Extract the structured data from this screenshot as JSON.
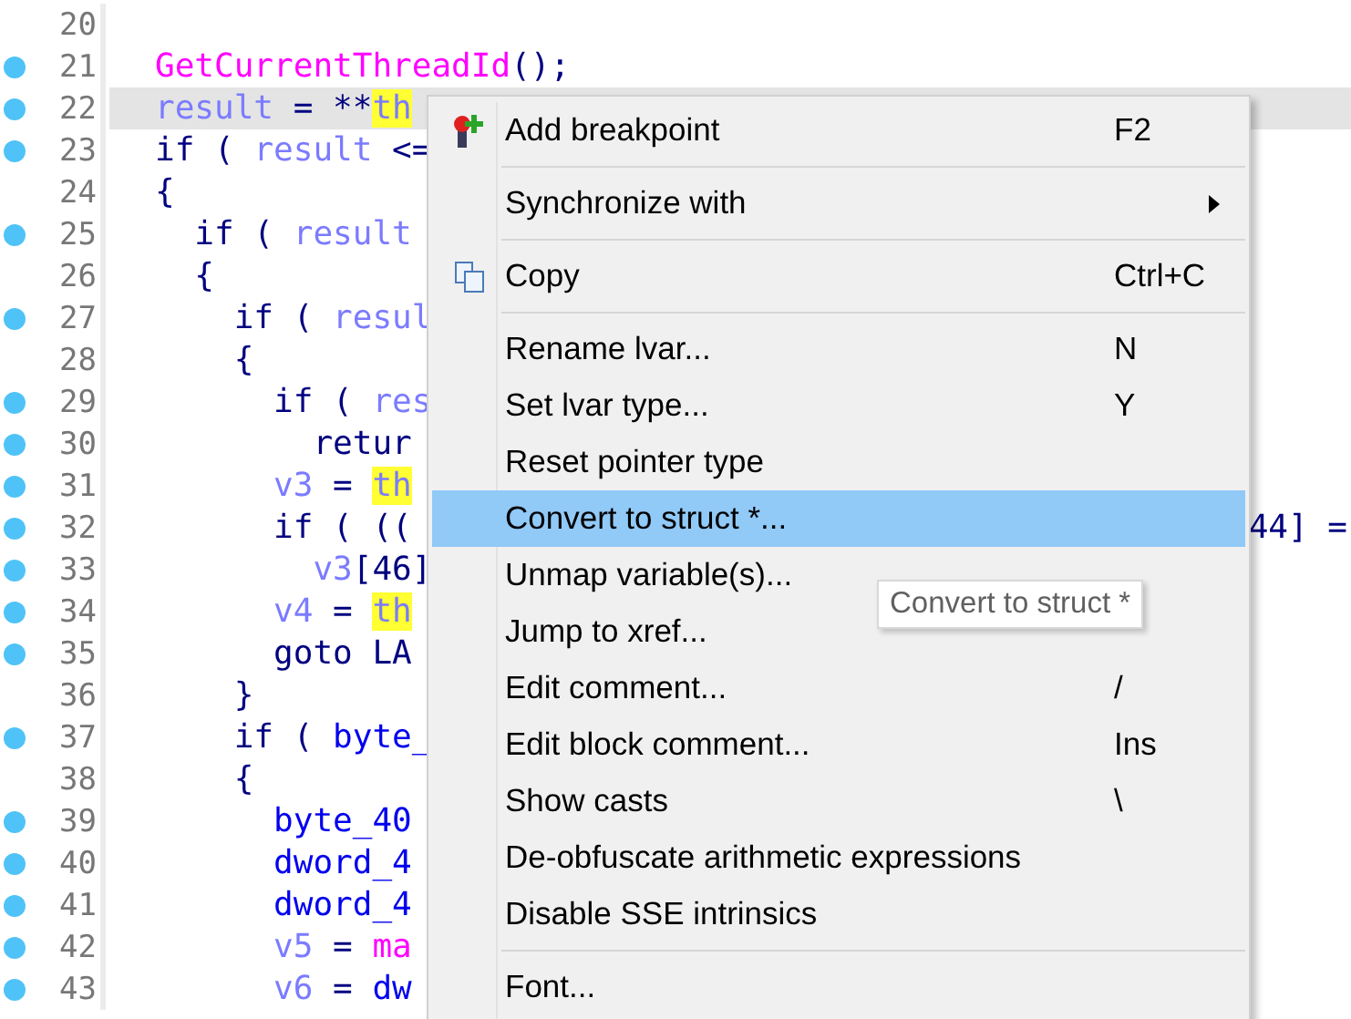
{
  "editor": {
    "lines": [
      {
        "number": "20",
        "breakpoint": false,
        "current": false
      },
      {
        "number": "21",
        "breakpoint": true,
        "current": false,
        "tokens": [
          {
            "text": "GetCurrentThreadId",
            "kind": "func"
          },
          {
            "text": "();",
            "kind": "plain"
          }
        ]
      },
      {
        "number": "22",
        "breakpoint": true,
        "current": true,
        "tokens": [
          {
            "text": "result",
            "kind": "var"
          },
          {
            "text": " = **",
            "kind": "plain"
          },
          {
            "text": "th",
            "kind": "highlight"
          }
        ]
      },
      {
        "number": "23",
        "breakpoint": true,
        "current": false,
        "tokens": [
          {
            "text": "if ( ",
            "kind": "plain"
          },
          {
            "text": "result",
            "kind": "var"
          },
          {
            "text": " <=",
            "kind": "plain"
          }
        ]
      },
      {
        "number": "24",
        "breakpoint": false,
        "current": false,
        "tokens": [
          {
            "text": "{",
            "kind": "plain"
          }
        ]
      },
      {
        "number": "25",
        "breakpoint": true,
        "current": false,
        "tokens": [
          {
            "text": "  if ( ",
            "kind": "plain"
          },
          {
            "text": "result",
            "kind": "var"
          }
        ]
      },
      {
        "number": "26",
        "breakpoint": false,
        "current": false,
        "tokens": [
          {
            "text": "  {",
            "kind": "plain"
          }
        ]
      },
      {
        "number": "27",
        "breakpoint": true,
        "current": false,
        "tokens": [
          {
            "text": "    if ( ",
            "kind": "plain"
          },
          {
            "text": "resul",
            "kind": "var"
          }
        ]
      },
      {
        "number": "28",
        "breakpoint": false,
        "current": false,
        "tokens": [
          {
            "text": "    {",
            "kind": "plain"
          }
        ]
      },
      {
        "number": "29",
        "breakpoint": true,
        "current": false,
        "tokens": [
          {
            "text": "      if ( ",
            "kind": "plain"
          },
          {
            "text": "res",
            "kind": "var"
          }
        ]
      },
      {
        "number": "30",
        "breakpoint": true,
        "current": false,
        "tokens": [
          {
            "text": "        retur",
            "kind": "plain"
          }
        ]
      },
      {
        "number": "31",
        "breakpoint": true,
        "current": false,
        "tokens": [
          {
            "text": "      v3",
            "kind": "var"
          },
          {
            "text": " = ",
            "kind": "plain"
          },
          {
            "text": "th",
            "kind": "highlight"
          }
        ]
      },
      {
        "number": "32",
        "breakpoint": true,
        "current": false,
        "tokens": [
          {
            "text": "      if ( ((",
            "kind": "plain"
          }
        ],
        "right_text": "44] ="
      },
      {
        "number": "33",
        "breakpoint": true,
        "current": false,
        "tokens": [
          {
            "text": "        v3",
            "kind": "var"
          },
          {
            "text": "[46]",
            "kind": "plain"
          }
        ]
      },
      {
        "number": "34",
        "breakpoint": true,
        "current": false,
        "tokens": [
          {
            "text": "      v4",
            "kind": "var"
          },
          {
            "text": " = ",
            "kind": "plain"
          },
          {
            "text": "th",
            "kind": "highlight"
          }
        ]
      },
      {
        "number": "35",
        "breakpoint": true,
        "current": false,
        "tokens": [
          {
            "text": "      goto LA",
            "kind": "plain"
          }
        ]
      },
      {
        "number": "36",
        "breakpoint": false,
        "current": false,
        "tokens": [
          {
            "text": "    }",
            "kind": "plain"
          }
        ]
      },
      {
        "number": "37",
        "breakpoint": true,
        "current": false,
        "tokens": [
          {
            "text": "    if ( ",
            "kind": "plain"
          },
          {
            "text": "byte_",
            "kind": "global"
          }
        ]
      },
      {
        "number": "38",
        "breakpoint": false,
        "current": false,
        "tokens": [
          {
            "text": "    {",
            "kind": "plain"
          }
        ]
      },
      {
        "number": "39",
        "breakpoint": true,
        "current": false,
        "tokens": [
          {
            "text": "      byte_40",
            "kind": "global"
          }
        ]
      },
      {
        "number": "40",
        "breakpoint": true,
        "current": false,
        "tokens": [
          {
            "text": "      dword_4",
            "kind": "global"
          }
        ]
      },
      {
        "number": "41",
        "breakpoint": true,
        "current": false,
        "tokens": [
          {
            "text": "      dword_4",
            "kind": "global"
          }
        ]
      },
      {
        "number": "42",
        "breakpoint": true,
        "current": false,
        "tokens": [
          {
            "text": "      v5",
            "kind": "var"
          },
          {
            "text": " = ",
            "kind": "plain"
          },
          {
            "text": "ma",
            "kind": "func"
          }
        ]
      },
      {
        "number": "43",
        "breakpoint": true,
        "current": false,
        "tokens": [
          {
            "text": "      v6",
            "kind": "var"
          },
          {
            "text": " = ",
            "kind": "plain"
          },
          {
            "text": "dw",
            "kind": "global"
          }
        ]
      }
    ]
  },
  "context_menu": {
    "items": [
      {
        "kind": "breakpoint",
        "label": "Add breakpoint",
        "shortcut": "F2",
        "selected": false
      },
      {
        "kind": "separator"
      },
      {
        "kind": "submenu",
        "label": "Synchronize with",
        "selected": false
      },
      {
        "kind": "separator"
      },
      {
        "kind": "copy",
        "label": "Copy",
        "shortcut": "Ctrl+C",
        "selected": false
      },
      {
        "kind": "separator"
      },
      {
        "kind": "item",
        "label": "Rename lvar...",
        "shortcut": "N",
        "selected": false
      },
      {
        "kind": "item",
        "label": "Set lvar type...",
        "shortcut": "Y",
        "selected": false
      },
      {
        "kind": "item",
        "label": "Reset pointer type",
        "selected": false
      },
      {
        "kind": "item",
        "label": "Convert to struct *...",
        "selected": true
      },
      {
        "kind": "item",
        "label": "Unmap variable(s)...",
        "selected": false
      },
      {
        "kind": "item",
        "label": "Jump to xref...",
        "selected": false
      },
      {
        "kind": "item",
        "label": "Edit comment...",
        "shortcut": "/",
        "selected": false
      },
      {
        "kind": "item",
        "label": "Edit block comment...",
        "shortcut": "Ins",
        "selected": false
      },
      {
        "kind": "item",
        "label": "Show casts",
        "shortcut": "\\",
        "selected": false
      },
      {
        "kind": "item",
        "label": "De-obfuscate arithmetic expressions",
        "selected": false
      },
      {
        "kind": "item",
        "label": "Disable SSE intrinsics",
        "selected": false
      },
      {
        "kind": "separator"
      },
      {
        "kind": "item",
        "label": "Font...",
        "selected": false
      }
    ]
  },
  "tooltip": {
    "text": "Convert to struct *"
  }
}
